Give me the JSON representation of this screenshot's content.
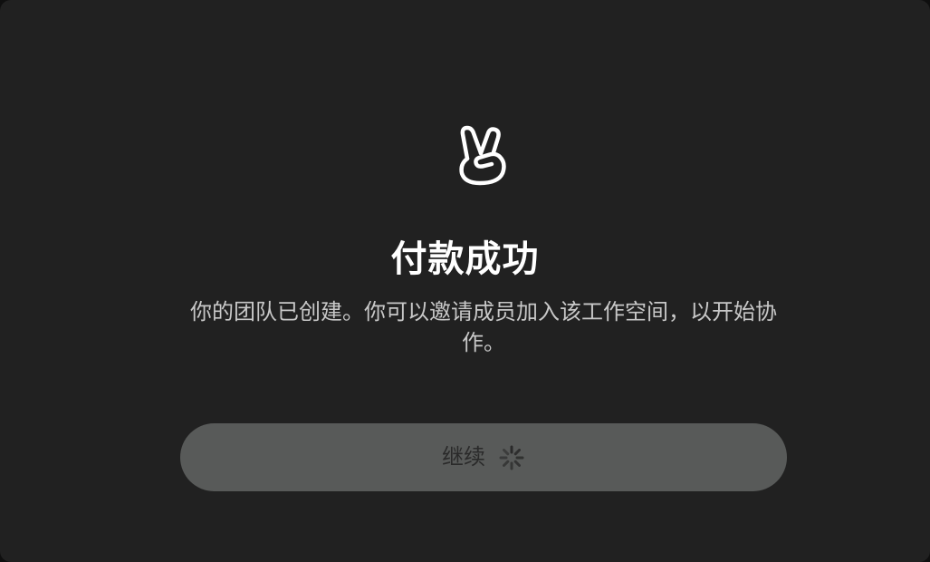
{
  "dialog": {
    "icon": "victory-hand-icon",
    "title": "付款成功",
    "message": "你的团队已创建。你可以邀请成员加入该工作空间，以开始协作。",
    "continue_button": {
      "label": "继续",
      "state_icon": "loading-spinner-icon"
    }
  },
  "colors": {
    "background": "#212121",
    "title": "#ffffff",
    "message": "#c8c8c8",
    "button_bg": "#585a59",
    "button_text": "#2a2a2a"
  }
}
